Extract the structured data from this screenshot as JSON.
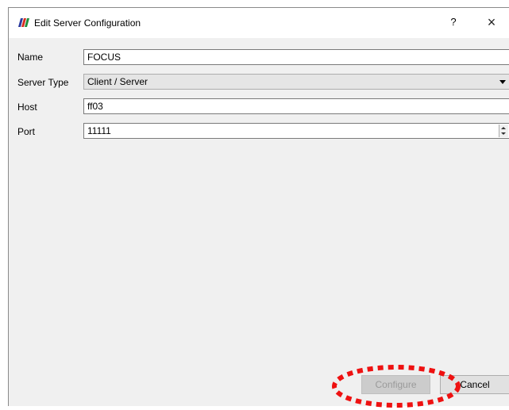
{
  "window": {
    "title": "Edit Server Configuration",
    "help_label": "?",
    "close_label": "×"
  },
  "form": {
    "name": {
      "label": "Name",
      "value": "FOCUS"
    },
    "server_type": {
      "label": "Server Type",
      "value": "Client / Server"
    },
    "host": {
      "label": "Host",
      "value": "ff03"
    },
    "port": {
      "label": "Port",
      "value": "11111"
    }
  },
  "buttons": {
    "configure_label": "Configure",
    "cancel_label": "Cancel"
  },
  "colors": {
    "highlight": "#ee1111",
    "icon_blue": "#2b3a9e",
    "icon_red": "#d62d20",
    "icon_green": "#1f8f3a"
  }
}
